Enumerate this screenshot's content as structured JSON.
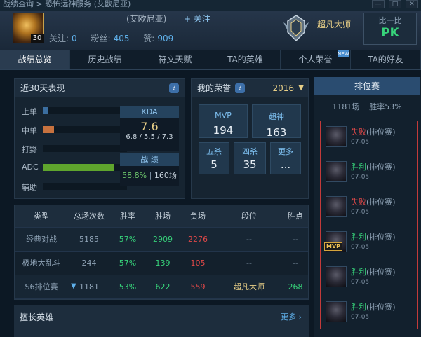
{
  "breadcrumb": "战绩查询 > 恐怖远神服务 (艾欧尼亚)",
  "window_controls": [
    "—",
    "□",
    "✕"
  ],
  "profile": {
    "level": "30",
    "server": "(艾欧尼亚)",
    "follow_label": "关注",
    "stats": [
      {
        "label": "关注:",
        "value": "0"
      },
      {
        "label": "粉丝:",
        "value": "405"
      },
      {
        "label": "赞:",
        "value": "909"
      }
    ],
    "rank_name": "超凡大师"
  },
  "pk": {
    "pre": "比一比",
    "label": "PK"
  },
  "tabs": [
    "战绩总览",
    "历史战绩",
    "符文天赋",
    "TA的英雄",
    "个人荣誉",
    "TA的好友"
  ],
  "tabs_active": 0,
  "tab_badge": "NEW",
  "recent": {
    "title": "近30天表现",
    "lanes": [
      {
        "name": "上单",
        "share": 0.04,
        "color": "#3b6ea0"
      },
      {
        "name": "中单",
        "share": 0.13,
        "color": "#c7723f"
      },
      {
        "name": "打野",
        "share": 0.0,
        "color": "#3b6ea0"
      },
      {
        "name": "ADC",
        "share": 0.85,
        "color": "#5fa52d"
      },
      {
        "name": "辅助",
        "share": 0.0,
        "color": "#3b6ea0"
      }
    ],
    "kda_label": "KDA",
    "kda": "7.6",
    "kda_parts": [
      "6.8",
      "5.5",
      "7.3"
    ],
    "record_label": "战 绩",
    "winrate": "58.8%",
    "games": "160场"
  },
  "glory": {
    "title": "我的荣誉",
    "year": "2016",
    "items": [
      {
        "label": "MVP",
        "value": "194"
      },
      {
        "label": "超神",
        "value": "163"
      },
      {
        "label": "五杀",
        "value": "5"
      },
      {
        "label": "四杀",
        "value": "35"
      },
      {
        "label": "更多",
        "value": "..."
      }
    ]
  },
  "table": {
    "headers": [
      "类型",
      "总场次数",
      "胜率",
      "胜场",
      "负场",
      "段位",
      "胜点"
    ],
    "rows": [
      [
        "经典对战",
        "5185",
        "57%",
        "2909",
        "2276",
        "--",
        "--"
      ],
      [
        "极地大乱斗",
        "244",
        "57%",
        "139",
        "105",
        "--",
        "--"
      ],
      [
        "S6排位赛",
        "1181",
        "53%",
        "622",
        "559",
        "超凡大师",
        "268"
      ]
    ]
  },
  "heroes": {
    "title": "擅长英雄",
    "more": "更多"
  },
  "ranked": {
    "tab": "排位赛",
    "games": "1181场",
    "winrate": "胜率53%",
    "matches": [
      {
        "result": "失败",
        "mode": "(排位赛)",
        "date": "07-05",
        "mvp": ""
      },
      {
        "result": "胜利",
        "mode": "(排位赛)",
        "date": "07-05",
        "mvp": ""
      },
      {
        "result": "失败",
        "mode": "(排位赛)",
        "date": "07-05",
        "mvp": ""
      },
      {
        "result": "胜利",
        "mode": "(排位赛)",
        "date": "07-05",
        "mvp": "MVP"
      },
      {
        "result": "胜利",
        "mode": "(排位赛)",
        "date": "07-05",
        "mvp": ""
      },
      {
        "result": "胜利",
        "mode": "(排位赛)",
        "date": "07-05",
        "mvp": ""
      }
    ]
  },
  "colors": {
    "win": "#37d37a",
    "loss": "#e04848",
    "accent": "#5fb0ea",
    "gold": "#e8cf87"
  }
}
